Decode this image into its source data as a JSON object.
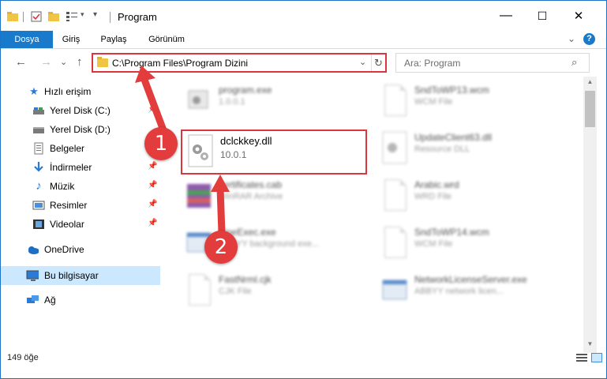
{
  "window": {
    "title": "Program",
    "minimize": "—",
    "maximize": "☐",
    "close": "✕"
  },
  "ribbon": {
    "tabs": [
      "Dosya",
      "Giriş",
      "Paylaş",
      "Görünüm"
    ],
    "collapse": "⌄",
    "help": "?"
  },
  "nav": {
    "back": "←",
    "forward": "→",
    "recent": "⌄",
    "up": "↑",
    "address": "C:\\Program Files\\Program Dizini",
    "dropdown": "⌄",
    "refresh": "↻",
    "search_placeholder": "Ara: Program",
    "search_icon": "⌕"
  },
  "sidebar": {
    "items": [
      {
        "label": "Hızlı erişim",
        "icon": "star-icon"
      },
      {
        "label": "Yerel Disk (C:)",
        "icon": "drive-icon"
      },
      {
        "label": "Yerel Disk (D:)",
        "icon": "drive-icon"
      },
      {
        "label": "Belgeler",
        "icon": "documents-icon"
      },
      {
        "label": "İndirmeler",
        "icon": "download-icon"
      },
      {
        "label": "Müzik",
        "icon": "music-icon"
      },
      {
        "label": "Resimler",
        "icon": "pictures-icon"
      },
      {
        "label": "Videolar",
        "icon": "video-icon"
      },
      {
        "label": "OneDrive",
        "icon": "cloud-icon"
      },
      {
        "label": "Bu bilgisayar",
        "icon": "computer-icon"
      },
      {
        "label": "Ağ",
        "icon": "network-icon"
      }
    ]
  },
  "files": [
    {
      "name": "program.exe",
      "sub": "1.0.0.1",
      "icon": "exe-icon"
    },
    {
      "name": "SndToWP13.wcm",
      "sub": "WCM File",
      "icon": "file-icon"
    },
    {
      "name": "dclckkey.dll",
      "sub": "10.0.1",
      "icon": "dll-gear-icon"
    },
    {
      "name": "UpdateClient63.dll",
      "sub": "Resource DLL",
      "icon": "dll-gear-icon"
    },
    {
      "name": "certificates.cab",
      "sub": "WinRAR Archive",
      "icon": "archive-icon"
    },
    {
      "name": "Arabic.wrd",
      "sub": "WRD File",
      "icon": "file-icon"
    },
    {
      "name": "FineExec.exe",
      "sub": "ABBYY background exe...",
      "icon": "exe-icon"
    },
    {
      "name": "SndToWP14.wcm",
      "sub": "WCM File",
      "icon": "file-icon"
    },
    {
      "name": "FastNrml.cjk",
      "sub": "CJK File",
      "icon": "file-icon"
    },
    {
      "name": "NetworkLicenseServer.exe",
      "sub": "ABBYY network licen...",
      "icon": "exe-icon"
    }
  ],
  "status": {
    "count": "149 öğe"
  },
  "annotations": {
    "step1": "1",
    "step2": "2"
  },
  "colors": {
    "accent": "#1979ca",
    "highlight": "#d9363e",
    "selection": "#cce8ff"
  }
}
